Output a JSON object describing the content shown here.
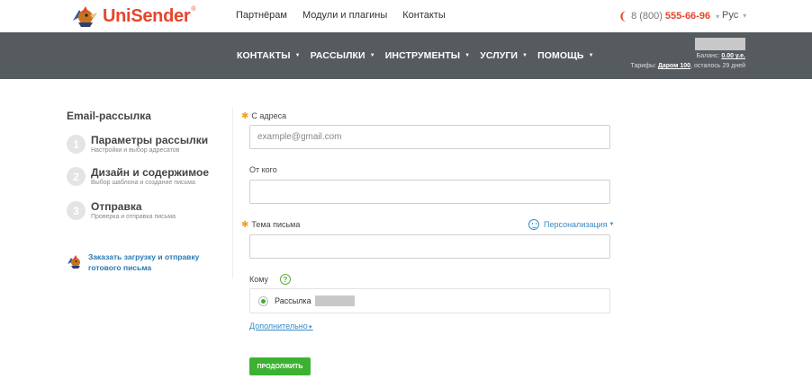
{
  "brand": {
    "name": "UniSender",
    "reg": "®",
    "accent": "#e8452c"
  },
  "topnav": {
    "items": [
      "Партнёрам",
      "Модули и плагины",
      "Контакты"
    ]
  },
  "phone": {
    "prefix": "8 (800)",
    "number": "555-66-96",
    "caret": "▾"
  },
  "lang": {
    "label": "Рус",
    "caret": "▾"
  },
  "menu": {
    "items": [
      {
        "label": "КОНТАКТЫ"
      },
      {
        "label": "РАССЫЛКИ"
      },
      {
        "label": "ИНСТРУМЕНТЫ"
      },
      {
        "label": "УСЛУГИ"
      },
      {
        "label": "ПОМОЩЬ"
      }
    ],
    "caret": "▼",
    "background": "#555b5f"
  },
  "account": {
    "balance_label": "Баланс:",
    "balance_value": "0.00 у.е.",
    "tariff_label": "Тарифы:",
    "tariff_name": "Даром 100",
    "tariff_rest": ", осталось 29 дней"
  },
  "sidebar": {
    "title": "Email-рассылка",
    "steps": [
      {
        "num": "1",
        "title": "Параметры рассылки",
        "sub": "Настройки и выбор адресатов"
      },
      {
        "num": "2",
        "title": "Дизайн и содержимое",
        "sub": "Выбор шаблона и создание письма"
      },
      {
        "num": "3",
        "title": "Отправка",
        "sub": "Проверка и отправка письма"
      }
    ],
    "order_link": "Заказать загрузку и отправку готового письма"
  },
  "form": {
    "required_mark": "✱",
    "from_address": {
      "label": "С адреса",
      "placeholder": "example@gmail.com",
      "value": ""
    },
    "from_name": {
      "label": "От кого",
      "value": ""
    },
    "subject": {
      "label": "Тема письма",
      "value": ""
    },
    "personalization": {
      "label": "Персонализация",
      "caret": "▼"
    },
    "recipients": {
      "label": "Кому",
      "help": "?",
      "option_label": "Рассылка",
      "selected": true
    },
    "more": {
      "label": "Дополнительно",
      "caret": "▼"
    },
    "continue_label": "ПРОДОЛЖИТЬ"
  }
}
